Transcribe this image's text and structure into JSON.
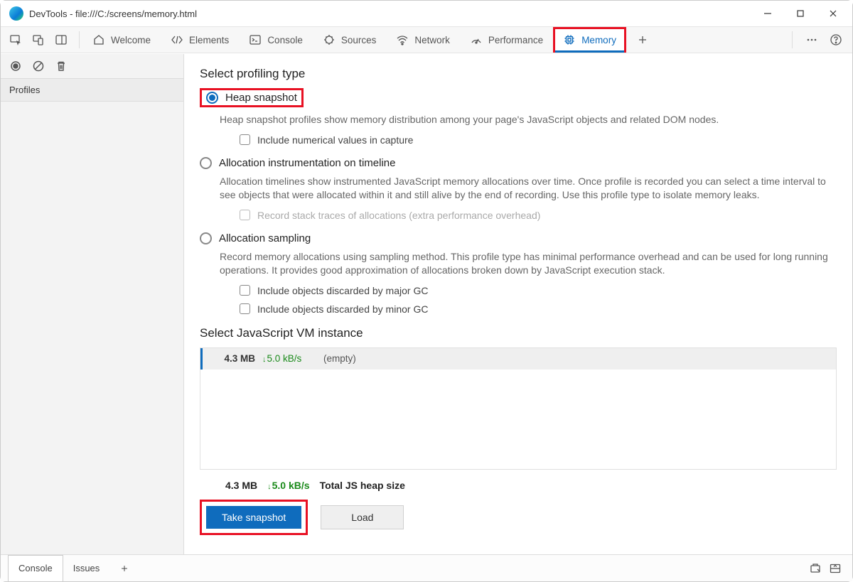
{
  "window": {
    "title": "DevTools - file:///C:/screens/memory.html"
  },
  "tabs": {
    "welcome": "Welcome",
    "elements": "Elements",
    "console": "Console",
    "sources": "Sources",
    "network": "Network",
    "performance": "Performance",
    "memory": "Memory"
  },
  "sidebar": {
    "heading": "Profiles"
  },
  "main": {
    "heading": "Select profiling type",
    "heap": {
      "title": "Heap snapshot",
      "desc": "Heap snapshot profiles show memory distribution among your page's JavaScript objects and related DOM nodes.",
      "chk1": "Include numerical values in capture"
    },
    "timeline": {
      "title": "Allocation instrumentation on timeline",
      "desc": "Allocation timelines show instrumented JavaScript memory allocations over time. Once profile is recorded you can select a time interval to see objects that were allocated within it and still alive by the end of recording. Use this profile type to isolate memory leaks.",
      "chk1": "Record stack traces of allocations (extra performance overhead)"
    },
    "sampling": {
      "title": "Allocation sampling",
      "desc": "Record memory allocations using sampling method. This profile type has minimal performance overhead and can be used for long running operations. It provides good approximation of allocations broken down by JavaScript execution stack.",
      "chk1": "Include objects discarded by major GC",
      "chk2": "Include objects discarded by minor GC"
    },
    "vm": {
      "heading": "Select JavaScript VM instance",
      "row": {
        "size": "4.3 MB",
        "rate": "5.0 kB/s",
        "name": "(empty)"
      }
    },
    "totals": {
      "size": "4.3 MB",
      "rate": "5.0 kB/s",
      "label": "Total JS heap size"
    },
    "actions": {
      "take": "Take snapshot",
      "load": "Load"
    }
  },
  "drawer": {
    "console": "Console",
    "issues": "Issues"
  }
}
